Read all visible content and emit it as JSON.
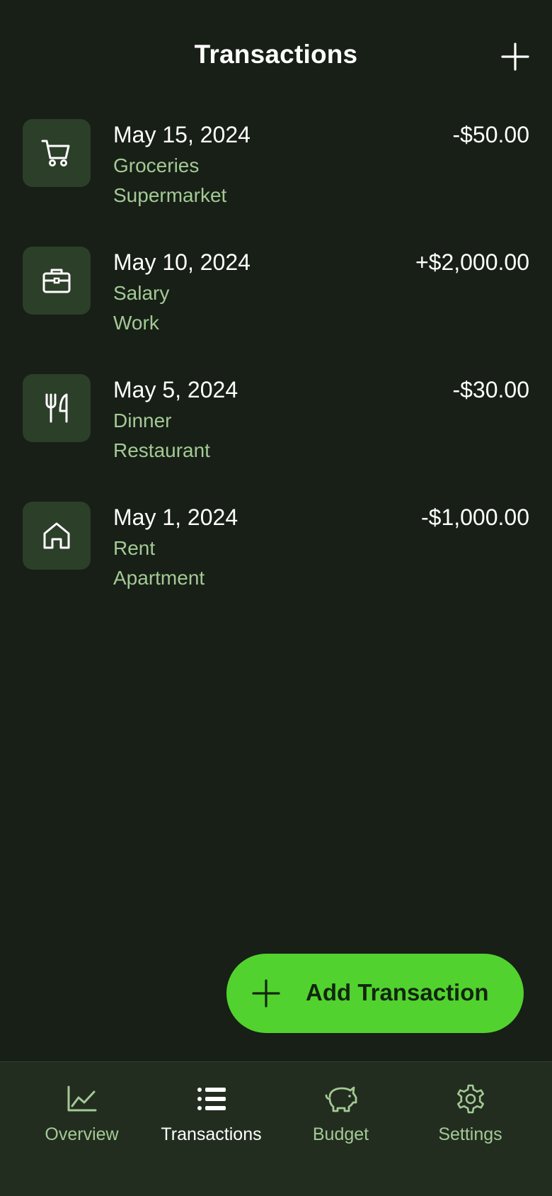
{
  "header": {
    "title": "Transactions",
    "add_icon": "plus-icon"
  },
  "transactions": [
    {
      "date": "May 15, 2024",
      "category": "Groceries",
      "merchant": "Supermarket",
      "amount": "-$50.00",
      "icon": "shopping-cart-icon"
    },
    {
      "date": "May 10, 2024",
      "category": "Salary",
      "merchant": "Work",
      "amount": "+$2,000.00",
      "icon": "briefcase-icon"
    },
    {
      "date": "May 5, 2024",
      "category": "Dinner",
      "merchant": "Restaurant",
      "amount": "-$30.00",
      "icon": "fork-knife-icon"
    },
    {
      "date": "May 1, 2024",
      "category": "Rent",
      "merchant": "Apartment",
      "amount": "-$1,000.00",
      "icon": "home-icon"
    }
  ],
  "fab": {
    "label": "Add Transaction",
    "icon": "plus-icon"
  },
  "bottom_nav": {
    "items": [
      {
        "label": "Overview",
        "icon": "chart-line-icon",
        "active": false
      },
      {
        "label": "Transactions",
        "icon": "list-icon",
        "active": true
      },
      {
        "label": "Budget",
        "icon": "piggy-bank-icon",
        "active": false
      },
      {
        "label": "Settings",
        "icon": "gear-icon",
        "active": false
      }
    ]
  },
  "colors": {
    "background": "#171f16",
    "icon_tile": "#2c3f29",
    "accent_green": "#52d22e",
    "muted_green_text": "#a4c995",
    "nav_background": "#222d20"
  }
}
